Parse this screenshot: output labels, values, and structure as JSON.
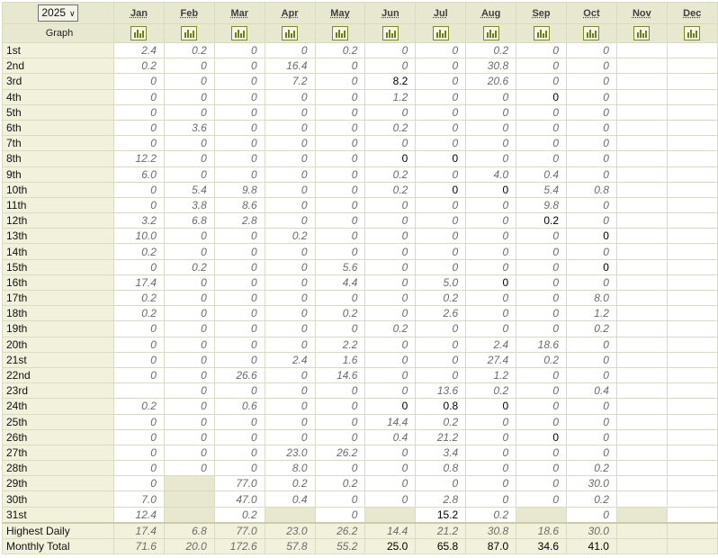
{
  "year_select": {
    "value": "2025"
  },
  "graph_label": "Graph",
  "months": [
    "Jan",
    "Feb",
    "Mar",
    "Apr",
    "May",
    "Jun",
    "Jul",
    "Aug",
    "Sep",
    "Oct",
    "Nov",
    "Dec"
  ],
  "rows": [
    {
      "label": "1st",
      "values": [
        "2.4",
        "0.2",
        "0",
        "0",
        "0.2",
        "0",
        "0",
        "0.2",
        "0",
        "0",
        "",
        ""
      ],
      "bold": []
    },
    {
      "label": "2nd",
      "values": [
        "0.2",
        "0",
        "0",
        "16.4",
        "0",
        "0",
        "0",
        "30.8",
        "0",
        "0",
        "",
        ""
      ],
      "bold": []
    },
    {
      "label": "3rd",
      "values": [
        "0",
        "0",
        "0",
        "7.2",
        "0",
        "8.2",
        "0",
        "20.6",
        "0",
        "0",
        "",
        ""
      ],
      "bold": [
        5
      ]
    },
    {
      "label": "4th",
      "values": [
        "0",
        "0",
        "0",
        "0",
        "0",
        "1.2",
        "0",
        "0",
        "0",
        "0",
        "",
        ""
      ],
      "bold": [
        8
      ]
    },
    {
      "label": "5th",
      "values": [
        "0",
        "0",
        "0",
        "0",
        "0",
        "0",
        "0",
        "0",
        "0",
        "0",
        "",
        ""
      ],
      "bold": []
    },
    {
      "label": "6th",
      "values": [
        "0",
        "3.6",
        "0",
        "0",
        "0",
        "0.2",
        "0",
        "0",
        "0",
        "0",
        "",
        ""
      ],
      "bold": []
    },
    {
      "label": "7th",
      "values": [
        "0",
        "0",
        "0",
        "0",
        "0",
        "0",
        "0",
        "0",
        "0",
        "0",
        "",
        ""
      ],
      "bold": []
    },
    {
      "label": "8th",
      "values": [
        "12.2",
        "0",
        "0",
        "0",
        "0",
        "0",
        "0",
        "0",
        "0",
        "0",
        "",
        ""
      ],
      "bold": [
        5,
        6
      ]
    },
    {
      "label": "9th",
      "values": [
        "6.0",
        "0",
        "0",
        "0",
        "0",
        "0.2",
        "0",
        "4.0",
        "0.4",
        "0",
        "",
        ""
      ],
      "bold": []
    },
    {
      "label": "10th",
      "values": [
        "0",
        "5.4",
        "9.8",
        "0",
        "0",
        "0.2",
        "0",
        "0",
        "5.4",
        "0.8",
        "",
        ""
      ],
      "bold": [
        6,
        7
      ]
    },
    {
      "label": "11th",
      "values": [
        "0",
        "3.8",
        "8.6",
        "0",
        "0",
        "0",
        "0",
        "0",
        "9.8",
        "0",
        "",
        ""
      ],
      "bold": []
    },
    {
      "label": "12th",
      "values": [
        "3.2",
        "6.8",
        "2.8",
        "0",
        "0",
        "0",
        "0",
        "0",
        "0.2",
        "0",
        "",
        ""
      ],
      "bold": [
        8
      ]
    },
    {
      "label": "13th",
      "values": [
        "10.0",
        "0",
        "0",
        "0.2",
        "0",
        "0",
        "0",
        "0",
        "0",
        "0",
        "",
        ""
      ],
      "bold": [
        9
      ]
    },
    {
      "label": "14th",
      "values": [
        "0.2",
        "0",
        "0",
        "0",
        "0",
        "0",
        "0",
        "0",
        "0",
        "0",
        "",
        ""
      ],
      "bold": []
    },
    {
      "label": "15th",
      "values": [
        "0",
        "0.2",
        "0",
        "0",
        "5.6",
        "0",
        "0",
        "0",
        "0",
        "0",
        "",
        ""
      ],
      "bold": [
        9
      ]
    },
    {
      "label": "16th",
      "values": [
        "17.4",
        "0",
        "0",
        "0",
        "4.4",
        "0",
        "5.0",
        "0",
        "0",
        "0",
        "",
        ""
      ],
      "bold": [
        7
      ]
    },
    {
      "label": "17th",
      "values": [
        "0.2",
        "0",
        "0",
        "0",
        "0",
        "0",
        "0.2",
        "0",
        "0",
        "8.0",
        "",
        ""
      ],
      "bold": []
    },
    {
      "label": "18th",
      "values": [
        "0.2",
        "0",
        "0",
        "0",
        "0.2",
        "0",
        "2.6",
        "0",
        "0",
        "1.2",
        "",
        ""
      ],
      "bold": []
    },
    {
      "label": "19th",
      "values": [
        "0",
        "0",
        "0",
        "0",
        "0",
        "0.2",
        "0",
        "0",
        "0",
        "0.2",
        "",
        ""
      ],
      "bold": []
    },
    {
      "label": "20th",
      "values": [
        "0",
        "0",
        "0",
        "0",
        "2.2",
        "0",
        "0",
        "2.4",
        "18.6",
        "0",
        "",
        ""
      ],
      "bold": []
    },
    {
      "label": "21st",
      "values": [
        "0",
        "0",
        "0",
        "2.4",
        "1.6",
        "0",
        "0",
        "27.4",
        "0.2",
        "0",
        "",
        ""
      ],
      "bold": []
    },
    {
      "label": "22nd",
      "values": [
        "0",
        "0",
        "26.6",
        "0",
        "14.6",
        "0",
        "0",
        "1.2",
        "0",
        "0",
        "",
        ""
      ],
      "bold": []
    },
    {
      "label": "23rd",
      "values": [
        "",
        "0",
        "0",
        "0",
        "0",
        "0",
        "13.6",
        "0.2",
        "0",
        "0.4",
        "",
        ""
      ],
      "bold": []
    },
    {
      "label": "24th",
      "values": [
        "0.2",
        "0",
        "0.6",
        "0",
        "0",
        "0",
        "0.8",
        "0",
        "0",
        "0",
        "",
        ""
      ],
      "bold": [
        5,
        6,
        7
      ]
    },
    {
      "label": "25th",
      "values": [
        "0",
        "0",
        "0",
        "0",
        "0",
        "14.4",
        "0.2",
        "0",
        "0",
        "0",
        "",
        ""
      ],
      "bold": []
    },
    {
      "label": "26th",
      "values": [
        "0",
        "0",
        "0",
        "0",
        "0",
        "0.4",
        "21.2",
        "0",
        "0",
        "0",
        "",
        ""
      ],
      "bold": [
        8
      ]
    },
    {
      "label": "27th",
      "values": [
        "0",
        "0",
        "0",
        "23.0",
        "26.2",
        "0",
        "3.4",
        "0",
        "0",
        "0",
        "",
        ""
      ],
      "bold": []
    },
    {
      "label": "28th",
      "values": [
        "0",
        "0",
        "0",
        "8.0",
        "0",
        "0",
        "0.8",
        "0",
        "0",
        "0.2",
        "",
        ""
      ],
      "bold": []
    },
    {
      "label": "29th",
      "values": [
        "0",
        "",
        "77.0",
        "0.2",
        "0.2",
        "0",
        "0",
        "0",
        "0",
        "30.0",
        "",
        ""
      ],
      "bold": [],
      "na": [
        1
      ]
    },
    {
      "label": "30th",
      "values": [
        "7.0",
        "",
        "47.0",
        "0.4",
        "0",
        "0",
        "2.8",
        "0",
        "0",
        "0.2",
        "",
        ""
      ],
      "bold": [],
      "na": [
        1
      ]
    },
    {
      "label": "31st",
      "values": [
        "12.4",
        "",
        "0.2",
        "",
        "0",
        "",
        "15.2",
        "0.2",
        "",
        "0",
        "",
        ""
      ],
      "bold": [
        6
      ],
      "na": [
        1,
        3,
        5,
        8,
        10
      ]
    }
  ],
  "totals": [
    {
      "label": "Highest Daily",
      "values": [
        "17.4",
        "6.8",
        "77.0",
        "23.0",
        "26.2",
        "14.4",
        "21.2",
        "30.8",
        "18.6",
        "30.0",
        "",
        ""
      ],
      "bold": []
    },
    {
      "label": "Monthly Total",
      "values": [
        "71.6",
        "20.0",
        "172.6",
        "57.8",
        "55.2",
        "25.0",
        "65.8",
        "87.0",
        "34.6",
        "41.0",
        "",
        ""
      ],
      "bold": [
        5,
        6,
        7,
        8,
        9
      ]
    }
  ]
}
